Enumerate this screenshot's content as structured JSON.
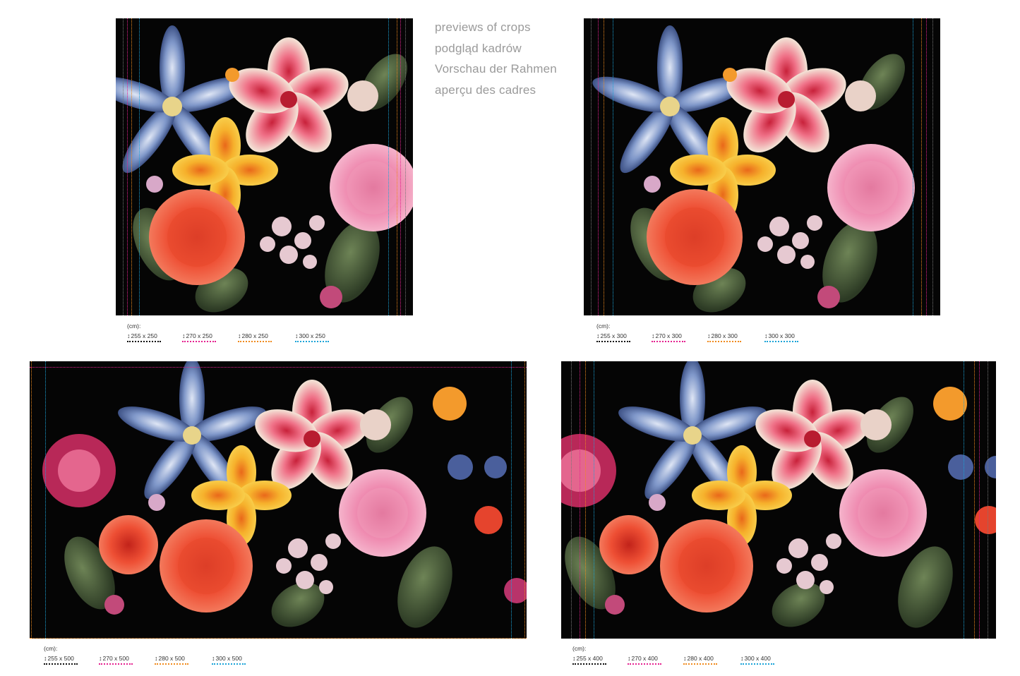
{
  "heading": {
    "lines": [
      "previews of crops",
      "podgląd kadrów",
      "Vorschau der Rahmen",
      "aperçu des cadres"
    ]
  },
  "colors": {
    "crop_1": "#111111",
    "crop_2": "#e5208f",
    "crop_3": "#f08a1c",
    "crop_4": "#1aa3d8",
    "heading_text": "#9a9a9a",
    "panel_bg": "#050505"
  },
  "panels": [
    {
      "id": "panel-250",
      "legend": {
        "unit": "(cm):",
        "items": [
          {
            "label": "255 x 250"
          },
          {
            "label": "270 x 250"
          },
          {
            "label": "280 x 250"
          },
          {
            "label": "300 x 250"
          }
        ]
      }
    },
    {
      "id": "panel-300",
      "legend": {
        "unit": "(cm):",
        "items": [
          {
            "label": "255 x 300"
          },
          {
            "label": "270 x 300"
          },
          {
            "label": "280 x 300"
          },
          {
            "label": "300 x 300"
          }
        ]
      }
    },
    {
      "id": "panel-500",
      "legend": {
        "unit": "(cm):",
        "items": [
          {
            "label": "255 x 500"
          },
          {
            "label": "270 x 500"
          },
          {
            "label": "280 x 500"
          },
          {
            "label": "300 x 500"
          }
        ]
      }
    },
    {
      "id": "panel-400",
      "legend": {
        "unit": "(cm):",
        "items": [
          {
            "label": "255 x 400"
          },
          {
            "label": "270 x 400"
          },
          {
            "label": "280 x 400"
          },
          {
            "label": "300 x 400"
          }
        ]
      }
    }
  ]
}
